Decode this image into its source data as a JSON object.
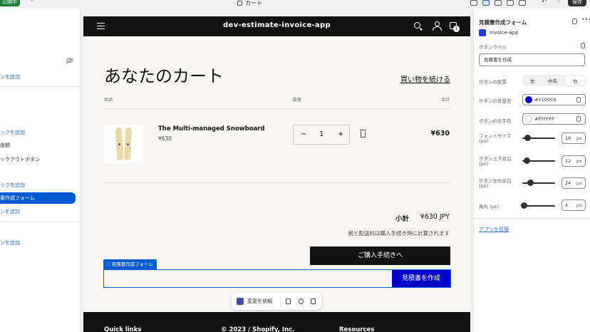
{
  "topbar": {
    "status_badge": "公開中",
    "chevron": "⌃",
    "tab_title": "カート",
    "undo_icon": "↶",
    "redo_icon": "↷",
    "save_label": "保存"
  },
  "left_sidebar": {
    "items": [
      {
        "label": "ンを追加",
        "type": "link"
      },
      {
        "label": "ックを追加",
        "type": "link"
      },
      {
        "label": "金額",
        "type": "plain"
      },
      {
        "label": "ックアウトボタン",
        "type": "plain"
      },
      {
        "label": "ックを追加",
        "type": "link"
      },
      {
        "label": "書作成フォーム",
        "type": "active"
      },
      {
        "label": "ンを追加",
        "type": "link"
      },
      {
        "label": "ンを追加",
        "type": "link"
      }
    ]
  },
  "store": {
    "name": "dev-estimate-invoice-app",
    "cart_count": "1",
    "cart_title": "あなたのカート",
    "continue_shopping": "買い物を続ける",
    "columns": {
      "product": "商品",
      "quantity": "数量",
      "total": "合計"
    },
    "item": {
      "name": "The Multi-managed Snowboard",
      "price": "¥630",
      "quantity": "1",
      "minus": "−",
      "plus": "+",
      "line_total": "¥630"
    },
    "subtotal_label": "小計",
    "subtotal_value": "¥630 JPY",
    "tax_note": "税と配送料は購入手続き時に計算されます",
    "checkout_label": "ご購入手続きへ",
    "block_tag": "⛶ 見積書作成フォーム",
    "estimate_button": "見積書を作成",
    "float_toolbar": {
      "request_label": "変更を依頼"
    },
    "footer": {
      "col1": "Quick links",
      "col2": "© 2023 / Shopify, Inc.",
      "col3": "Resources"
    }
  },
  "right_panel": {
    "title": "見積書作成フォーム",
    "more_icon": "•••",
    "app_name": "invoice-app",
    "button_label_title": "ボタンラベル",
    "button_label_value": "見積書を作成",
    "alignment_title": "ボタンの配置",
    "alignment_options": [
      "左",
      "中央",
      "右"
    ],
    "alignment_selected": "右",
    "bg_color_title": "ボタンの背景色",
    "bg_color_value": "#0100C6",
    "text_color_title": "ボタンの文字色",
    "text_color_value": "#FFFFFF",
    "font_size": {
      "title1": "フォントサイズ",
      "title2": "(px)",
      "value": "16",
      "unit": "px",
      "min": 0,
      "max": 100
    },
    "padding_v": {
      "title1": "ボタン上下余白",
      "title2": "(px)",
      "value": "12",
      "unit": "px",
      "min": 0,
      "max": 100
    },
    "padding_h": {
      "title1": "ボタン左右余白",
      "title2": "(px)",
      "value": "24",
      "unit": "px",
      "min": 0,
      "max": 100
    },
    "radius": {
      "title1": "角丸 (px)",
      "value": "4",
      "unit": "px",
      "min": 0,
      "max": 100
    },
    "manage_app": "アプリを管理"
  },
  "colors": {
    "accent": "#005bd3",
    "estimate_button_bg": "#0100c6",
    "estimate_button_text": "#ffffff",
    "header_bg": "#121212"
  }
}
